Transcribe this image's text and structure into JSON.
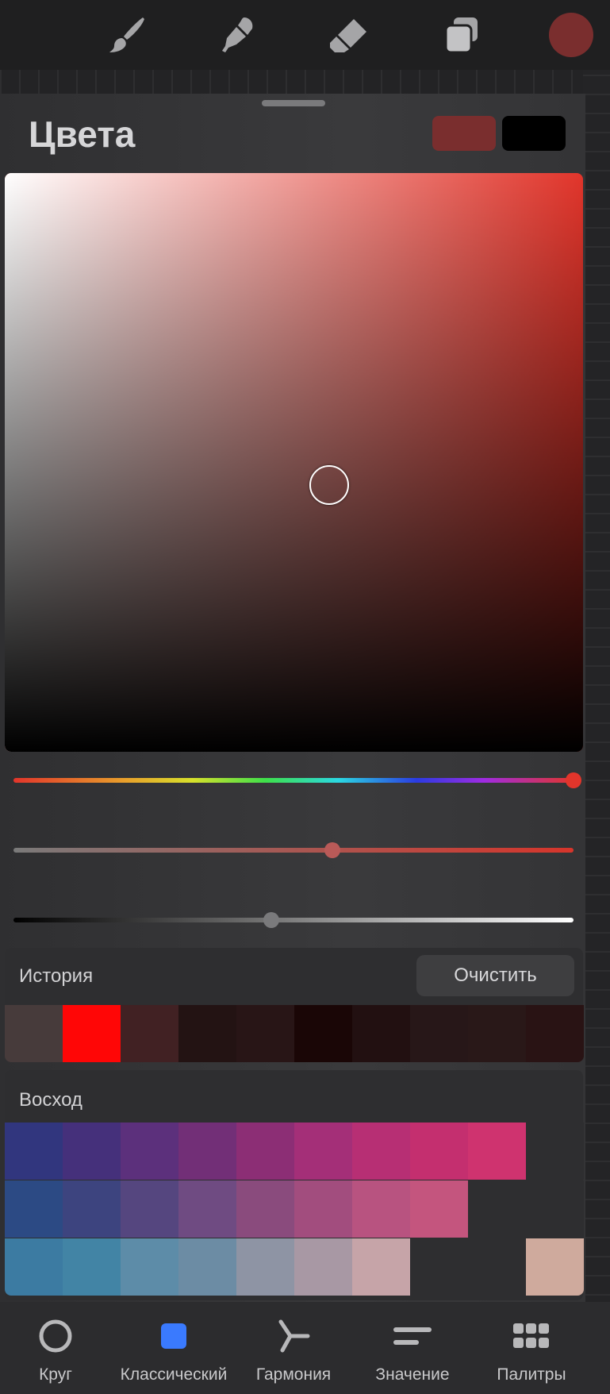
{
  "header": {
    "tools": [
      "brush-icon",
      "smudge-icon",
      "eraser-icon",
      "layers-icon"
    ],
    "current_color": "#7a2e2e"
  },
  "panel": {
    "title": "Цвета",
    "primary_swatch": "#7a2e2e",
    "secondary_swatch": "#000000"
  },
  "picker": {
    "hue_color": "#e2352b",
    "hue_position": 1.0,
    "saturation_position": 0.57,
    "brightness_position": 0.46
  },
  "history": {
    "label": "История",
    "clear_label": "Очистить",
    "swatches": [
      "#473b3b",
      "#ff0606",
      "#412123",
      "#231313",
      "#281516",
      "#1a0606",
      "#221011",
      "#271718",
      "#291818",
      "#291314"
    ]
  },
  "palette": {
    "name": "Восход",
    "rows": [
      [
        "#31367e",
        "#45307b",
        "#5c307c",
        "#722f77",
        "#8c2e75",
        "#a42f78",
        "#b72f74",
        "#c42f6f",
        "#cf336f",
        "#2e2e30"
      ],
      [
        "#2c4a84",
        "#3d447f",
        "#55467f",
        "#6f4b82",
        "#8a4b7d",
        "#a24d7e",
        "#b85380",
        "#c4557e",
        "#2e2e30",
        "#2e2e30"
      ],
      [
        "#3c7ba2",
        "#4284a5",
        "#5d8ca8",
        "#6c8ca4",
        "#8e94a4",
        "#a898a4",
        "#c6a4a8",
        "#2e2e30",
        "#2e2e30",
        "#cfaa9d"
      ]
    ]
  },
  "tabs": [
    {
      "label": "Круг",
      "icon": "circle-icon",
      "active": false
    },
    {
      "label": "Классический",
      "icon": "square-icon",
      "active": true
    },
    {
      "label": "Гармония",
      "icon": "harmony-icon",
      "active": false
    },
    {
      "label": "Значение",
      "icon": "value-icon",
      "active": false
    },
    {
      "label": "Палитры",
      "icon": "palettes-icon",
      "active": false
    }
  ],
  "colors": {
    "accent": "#3a7afe"
  }
}
